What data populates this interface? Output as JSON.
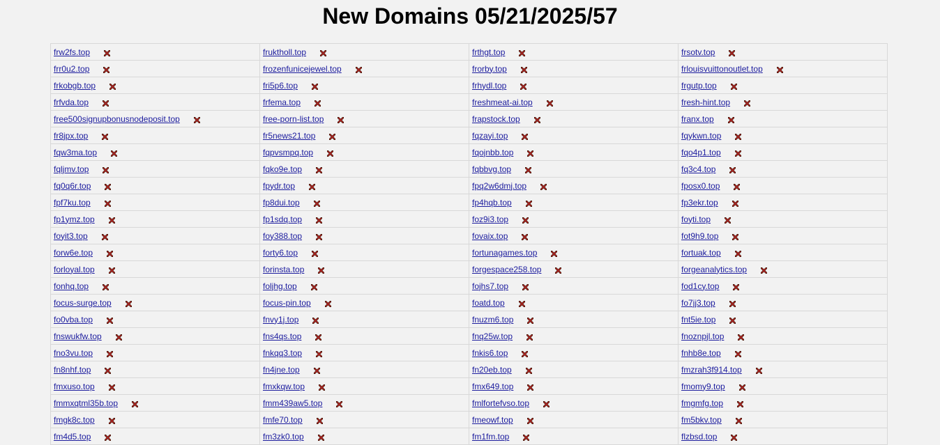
{
  "title": "New Domains 05/21/2025/57",
  "icons": {
    "delete": "delete-x-icon"
  },
  "colors": {
    "link": "#1c1c9e",
    "delete_icon": "#b22222",
    "background": "#f2f2f2"
  },
  "rows": [
    [
      "frw2fs.top",
      "fruktholl.top",
      "frthgt.top",
      "frsotv.top"
    ],
    [
      "frr0u2.top",
      "frozenfunicejewel.top",
      "frorby.top",
      "frlouisvuittonoutlet.top"
    ],
    [
      "frkobgb.top",
      "fri5p6.top",
      "frhydl.top",
      "frgutp.top"
    ],
    [
      "frfvda.top",
      "frfema.top",
      "freshmeat-ai.top",
      "fresh-hint.top"
    ],
    [
      "free500signupbonusnodeposit.top",
      "free-porn-list.top",
      "frapstock.top",
      "franx.top"
    ],
    [
      "fr8jpx.top",
      "fr5news21.top",
      "fqzayi.top",
      "fqykwn.top"
    ],
    [
      "fqw3ma.top",
      "fqpvsmpq.top",
      "fqojnbb.top",
      "fqo4p1.top"
    ],
    [
      "fqljmv.top",
      "fqko9e.top",
      "fqbbvg.top",
      "fq3c4.top"
    ],
    [
      "fq0q6r.top",
      "fpydr.top",
      "fpq2w6dmj.top",
      "fposx0.top"
    ],
    [
      "fpf7ku.top",
      "fp8dui.top",
      "fp4hqb.top",
      "fp3ekr.top"
    ],
    [
      "fp1ymz.top",
      "fp1sdq.top",
      "foz9i3.top",
      "foyti.top"
    ],
    [
      "foyit3.top",
      "foy388.top",
      "fovaix.top",
      "fot9h9.top"
    ],
    [
      "forw6e.top",
      "forty6.top",
      "fortunagames.top",
      "fortuak.top"
    ],
    [
      "forloyal.top",
      "forinsta.top",
      "forgespace258.top",
      "forgeanalytics.top"
    ],
    [
      "fonhq.top",
      "foljhg.top",
      "fojhs7.top",
      "fod1cy.top"
    ],
    [
      "focus-surge.top",
      "focus-pin.top",
      "foatd.top",
      "fo7jj3.top"
    ],
    [
      "fo0vba.top",
      "fnvy1j.top",
      "fnuzm6.top",
      "fnt5ie.top"
    ],
    [
      "fnswukfw.top",
      "fns4qs.top",
      "fnq25w.top",
      "fnoznpjl.top"
    ],
    [
      "fno3vu.top",
      "fnkqq3.top",
      "fnkis6.top",
      "fnhb8e.top"
    ],
    [
      "fn8nhf.top",
      "fn4jne.top",
      "fn20eb.top",
      "fmzrah3f914.top"
    ],
    [
      "fmxuso.top",
      "fmxkqw.top",
      "fmx649.top",
      "fmomy9.top"
    ],
    [
      "fmmxqtml35b.top",
      "fmm439aw5.top",
      "fmlfortefvso.top",
      "fmgmfg.top"
    ],
    [
      "fmgk8c.top",
      "fmfe70.top",
      "fmeowf.top",
      "fm5bkv.top"
    ],
    [
      "fm4d5.top",
      "fm3zk0.top",
      "fm1fm.top",
      "flzbsd.top"
    ]
  ]
}
